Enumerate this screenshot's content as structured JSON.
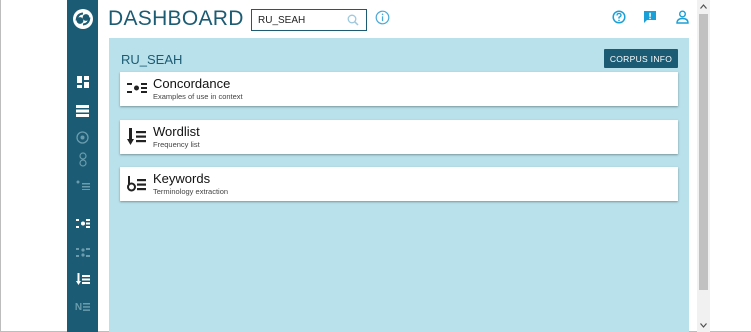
{
  "header": {
    "title": "DASHBOARD",
    "search_value": "RU_SEAH",
    "icons": [
      "info-icon",
      "help-icon",
      "feedback-icon",
      "user-icon"
    ]
  },
  "sidebar": {
    "logo": "sketch-engine-logo",
    "items": [
      {
        "icon": "dashboard-icon",
        "active": true
      },
      {
        "icon": "corpus-list-icon",
        "active": true
      },
      {
        "icon": "target-icon",
        "active": false
      },
      {
        "icon": "location-icon",
        "active": false
      },
      {
        "icon": "list-dots-icon",
        "active": false
      },
      {
        "icon": "concordance-icon",
        "active": true
      },
      {
        "icon": "parallel-concordance-icon",
        "active": false
      },
      {
        "icon": "wordlist-icon",
        "active": true
      },
      {
        "icon": "ngrams-icon",
        "active": false,
        "label": "N"
      }
    ]
  },
  "main": {
    "corpus_name": "RU_SEAH",
    "corpus_info_label": "CORPUS INFO",
    "cards": [
      {
        "title": "Concordance",
        "subtitle": "Examples of use in context",
        "icon": "concordance-icon"
      },
      {
        "title": "Wordlist",
        "subtitle": "Frequency list",
        "icon": "wordlist-icon"
      },
      {
        "title": "Keywords",
        "subtitle": "Terminology extraction",
        "icon": "keywords-icon"
      }
    ]
  },
  "colors": {
    "brand": "#1b5b73",
    "panel": "#b9e1eb",
    "accent": "#1a9fd6"
  }
}
